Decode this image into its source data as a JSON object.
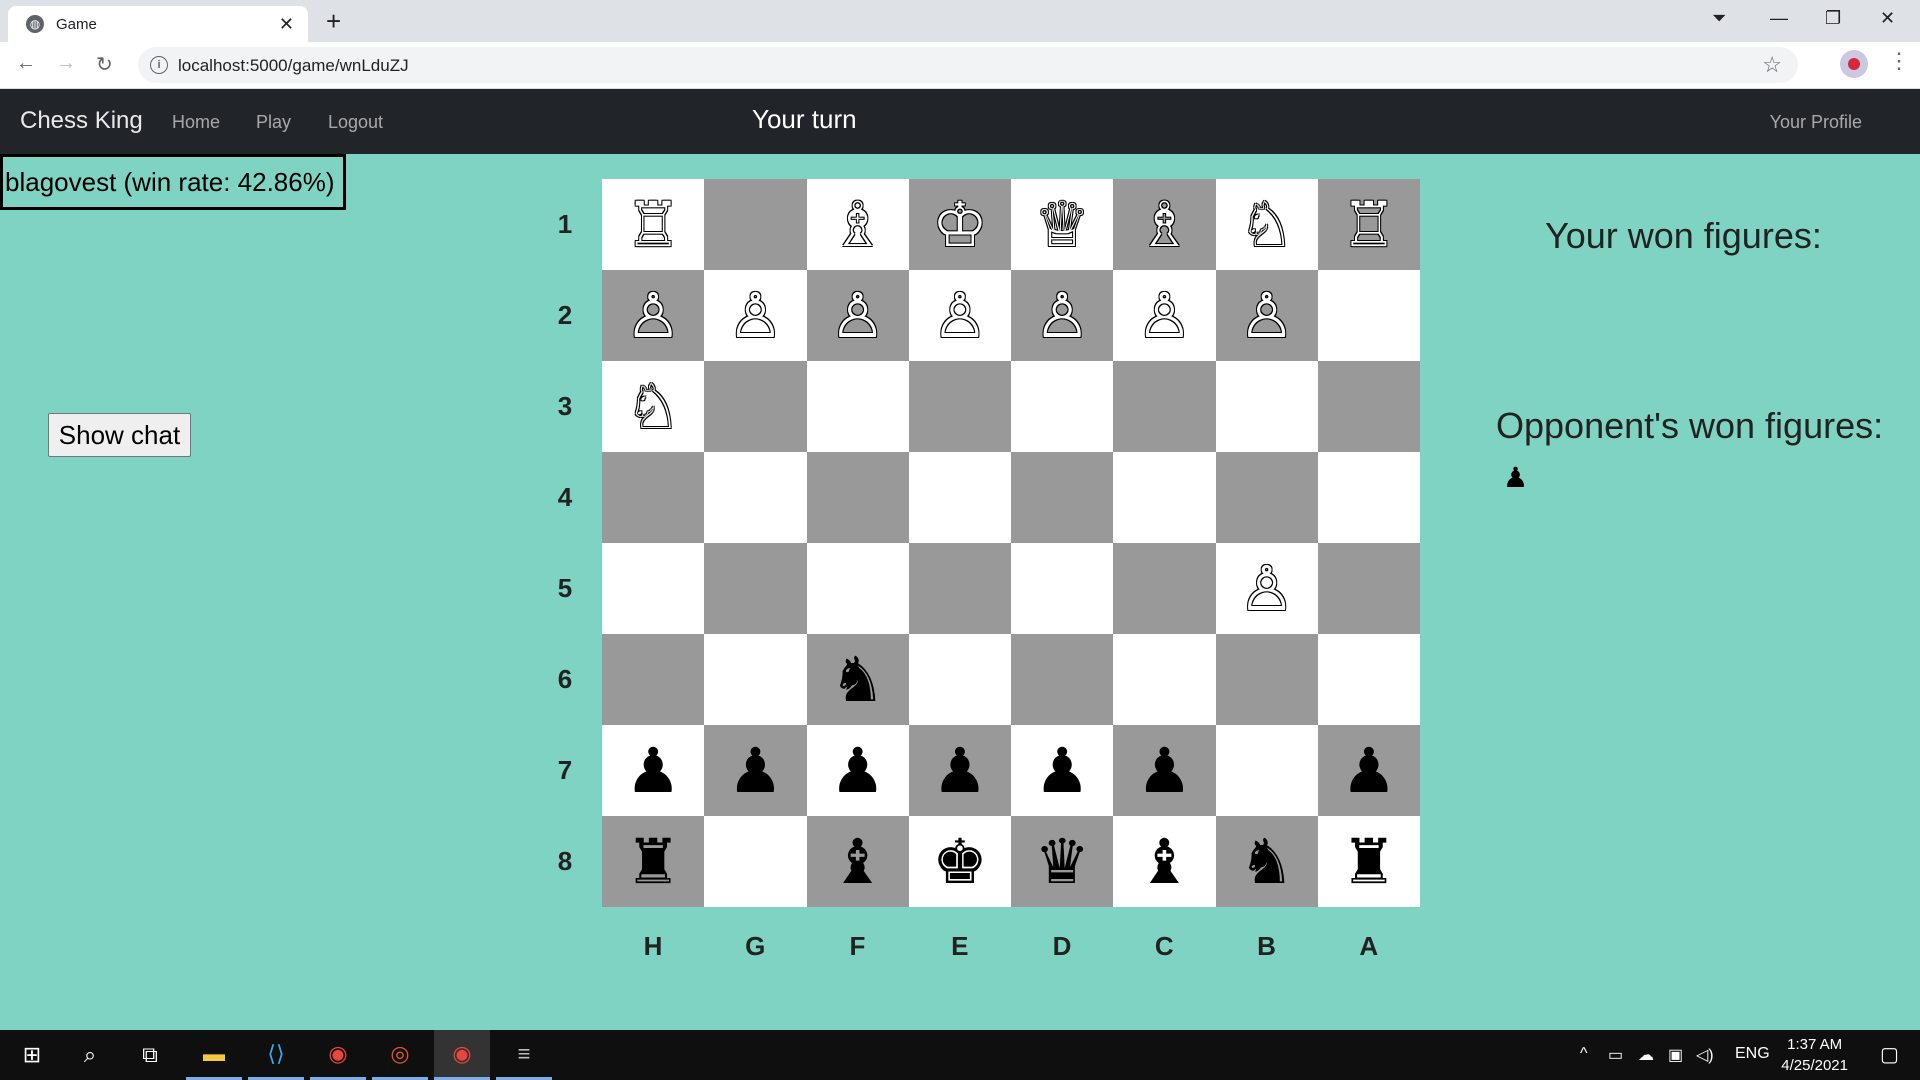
{
  "browser": {
    "tab_title": "Game",
    "url": "localhost:5000/game/wnLduZJ"
  },
  "app": {
    "brand": "Chess King",
    "nav": [
      {
        "label": "Home"
      },
      {
        "label": "Play"
      },
      {
        "label": "Logout"
      }
    ],
    "turn_status": "Your turn",
    "profile_link": "Your Profile"
  },
  "player_info": "blagovest (win rate: 42.86%)",
  "show_chat_label": "Show chat",
  "board": {
    "row_labels": [
      "1",
      "2",
      "3",
      "4",
      "5",
      "6",
      "7",
      "8"
    ],
    "col_labels": [
      "H",
      "G",
      "F",
      "E",
      "D",
      "C",
      "B",
      "A"
    ],
    "rows": [
      [
        "wR",
        "",
        "wB",
        "wK",
        "wQ",
        "wB",
        "wN",
        "wR"
      ],
      [
        "wP",
        "wP",
        "wP",
        "wP",
        "wP",
        "wP",
        "wP",
        ""
      ],
      [
        "wN",
        "",
        "",
        "",
        "",
        "",
        "",
        ""
      ],
      [
        "",
        "",
        "",
        "",
        "",
        "",
        "",
        ""
      ],
      [
        "",
        "",
        "",
        "",
        "",
        "",
        "wP",
        ""
      ],
      [
        "",
        "",
        "bN",
        "",
        "",
        "",
        "",
        ""
      ],
      [
        "bP",
        "bP",
        "bP",
        "bP",
        "bP",
        "bP",
        "",
        "bP"
      ],
      [
        "bR",
        "",
        "bB",
        "bK",
        "bQ",
        "bB",
        "bN",
        "bR"
      ]
    ],
    "light_color": "#ffffff",
    "dark_color": "#999999"
  },
  "your_won_heading": "Your won figures:",
  "your_won_figures": [],
  "opponent_won_heading": "Opponent's won figures:",
  "opponent_won_figures": [
    "bP"
  ],
  "taskbar": {
    "language": "ENG",
    "time": "1:37 AM",
    "date": "4/25/2021"
  }
}
